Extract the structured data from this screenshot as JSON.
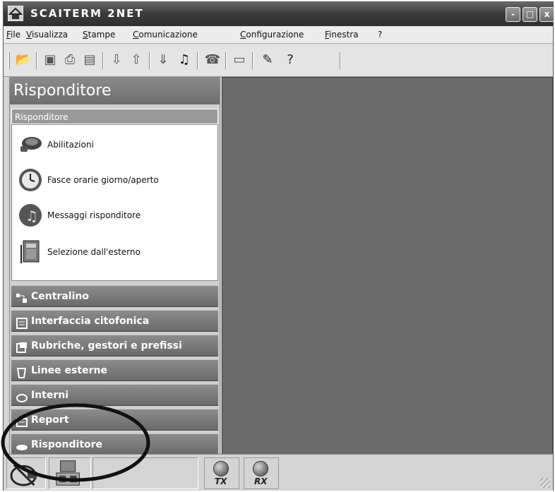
{
  "window": {
    "title": "SCAITERM 2NET",
    "controls": {
      "minimize": "-",
      "maximize": "□",
      "close": "x"
    }
  },
  "menu": {
    "items": [
      "File",
      "Visualizza",
      "Stampe",
      "Comunicazione",
      "Configurazione",
      "Finestra",
      "?"
    ]
  },
  "toolbar": {
    "buttons": [
      "open-folder-icon",
      "save-icon",
      "print-icon",
      "print-preview-icon",
      "download-icon",
      "upload-icon",
      "dl-icon",
      "music-icon",
      "phone-icon",
      "monitor-icon",
      "book-icon",
      "help-icon"
    ]
  },
  "left_panel": {
    "header": "Risponditore",
    "group": {
      "title": "Risponditore",
      "items": [
        {
          "label": "Abilitazioni",
          "icon": "abilitazioni-icon"
        },
        {
          "label": "Fasce orarie giorno/aperto",
          "icon": "clock-icon"
        },
        {
          "label": "Messaggi risponditore",
          "icon": "music-note-icon"
        },
        {
          "label": "Selezione dall'esterno",
          "icon": "intercom-panel-icon"
        }
      ]
    },
    "sections": [
      {
        "label": "Centralino",
        "icon": "network-icon"
      },
      {
        "label": "Interfaccia citofonica",
        "icon": "door-panel-icon"
      },
      {
        "label": "Rubriche, gestori e prefissi",
        "icon": "phonebook-icon"
      },
      {
        "label": "Linee esterne",
        "icon": "phone-line-icon"
      },
      {
        "label": "Interni",
        "icon": "internal-phone-icon"
      },
      {
        "label": "Report",
        "icon": "report-icon"
      },
      {
        "label": "Risponditore",
        "icon": "answering-icon"
      }
    ]
  },
  "statusbar": {
    "leds": [
      {
        "label": "TX"
      },
      {
        "label": "RX"
      }
    ],
    "colors": {
      "main_area": "#6b6b6b",
      "panel_header": "#7c7c7c"
    }
  }
}
